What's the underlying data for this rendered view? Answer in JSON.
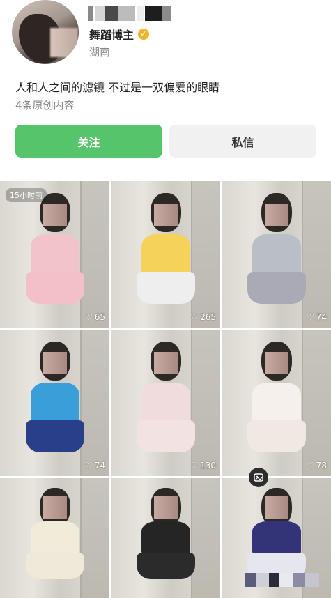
{
  "profile": {
    "username_obscured": true,
    "tagline": "舞蹈博主",
    "verified_icon": "verified-check-icon",
    "location": "湖南",
    "bio": "人和人之间的滤镜 不过是一双偏爱的眼睛",
    "post_count": "4条原创内容"
  },
  "actions": {
    "follow_label": "关注",
    "message_label": "私信"
  },
  "colors": {
    "follow_bg": "#55c46a",
    "message_bg": "#f1f1f1",
    "verify": "#f1b32a"
  },
  "grid": {
    "time_badge": "15小时前",
    "items": [
      {
        "likes": "65",
        "top": "#f2c3c9",
        "skirt": "#f3c0c8"
      },
      {
        "likes": "265",
        "top": "#f5d25a",
        "skirt": "#eeeeee"
      },
      {
        "likes": "74",
        "top": "#b9bec7",
        "skirt": "#a9aab6"
      },
      {
        "likes": "74",
        "top": "#3a9fd8",
        "skirt": "#2a3f8a"
      },
      {
        "likes": "130",
        "top": "#f0dcdc",
        "skirt": "#f3e2e2"
      },
      {
        "likes": "78",
        "top": "#f5f0ec",
        "skirt": "#efe8e3"
      },
      {
        "likes": "",
        "top": "#f1ebd9",
        "skirt": "#f0e9da"
      },
      {
        "likes": "",
        "top": "#252525",
        "skirt": "#2b2b2b"
      },
      {
        "likes": "",
        "top": "#323477",
        "skirt": "#e6e6ef"
      }
    ]
  },
  "icons": {
    "heart": "heart-icon",
    "image_add": "image-add-icon"
  }
}
